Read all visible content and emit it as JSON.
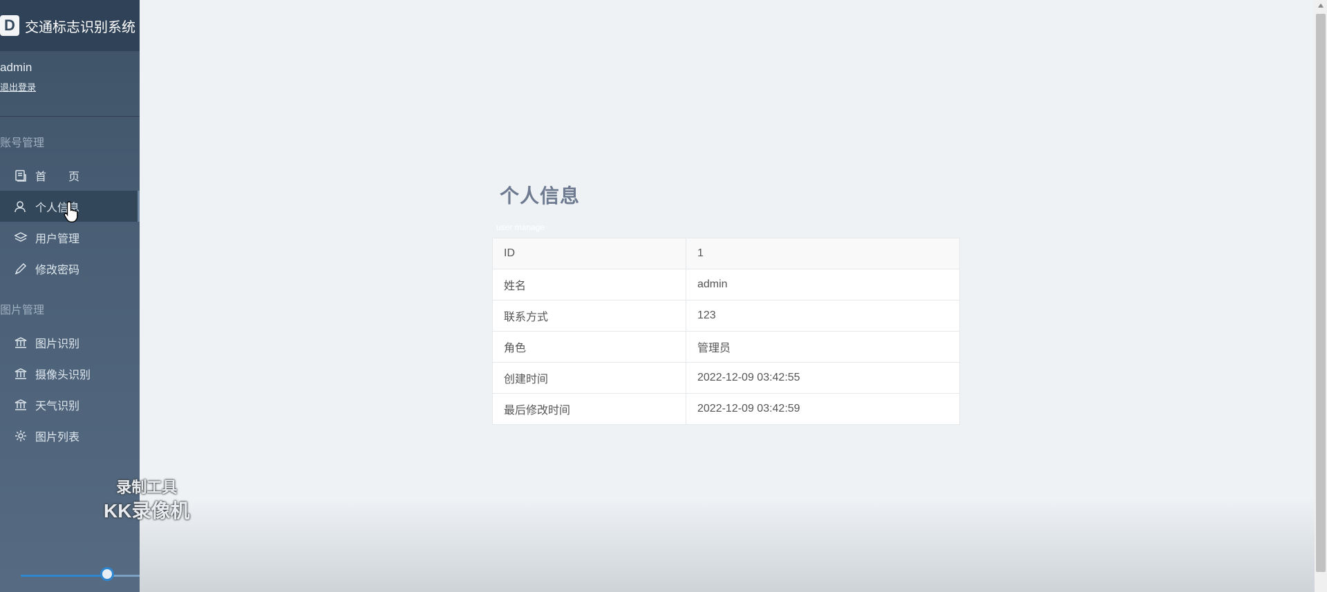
{
  "app": {
    "title": "交通标志识别系统",
    "logo_letter": "D"
  },
  "user": {
    "name": "admin",
    "logout_label": "退出登录"
  },
  "sidebar": {
    "sections": [
      {
        "title": "账号管理",
        "items": [
          {
            "label": "首　　页",
            "icon": "home-icon"
          },
          {
            "label": "个人信息",
            "icon": "user-icon",
            "active": true
          },
          {
            "label": "用户管理",
            "icon": "layers-icon"
          },
          {
            "label": "修改密码",
            "icon": "pencil-icon"
          }
        ]
      },
      {
        "title": "图片管理",
        "items": [
          {
            "label": "图片识别",
            "icon": "bank-icon"
          },
          {
            "label": "摄像头识别",
            "icon": "bank-icon"
          },
          {
            "label": "天气识别",
            "icon": "bank-icon"
          },
          {
            "label": "图片列表",
            "icon": "gear-icon"
          }
        ]
      }
    ]
  },
  "main": {
    "title": "个人信息",
    "subtitle": "user manage",
    "rows": [
      {
        "key": "ID",
        "value": "1"
      },
      {
        "key": "姓名",
        "value": "admin"
      },
      {
        "key": "联系方式",
        "value": "123"
      },
      {
        "key": "角色",
        "value": "管理员"
      },
      {
        "key": "创建时间",
        "value": "2022-12-09 03:42:55"
      },
      {
        "key": "最后修改时间",
        "value": "2022-12-09 03:42:59"
      }
    ]
  },
  "watermark": {
    "line1": "录制工具",
    "line2": "KK录像机"
  },
  "colors": {
    "sidebar": "#4a5f75",
    "brand_bar": "#2f4257",
    "accent": "#2f86d0",
    "background": "#eef2f5"
  }
}
